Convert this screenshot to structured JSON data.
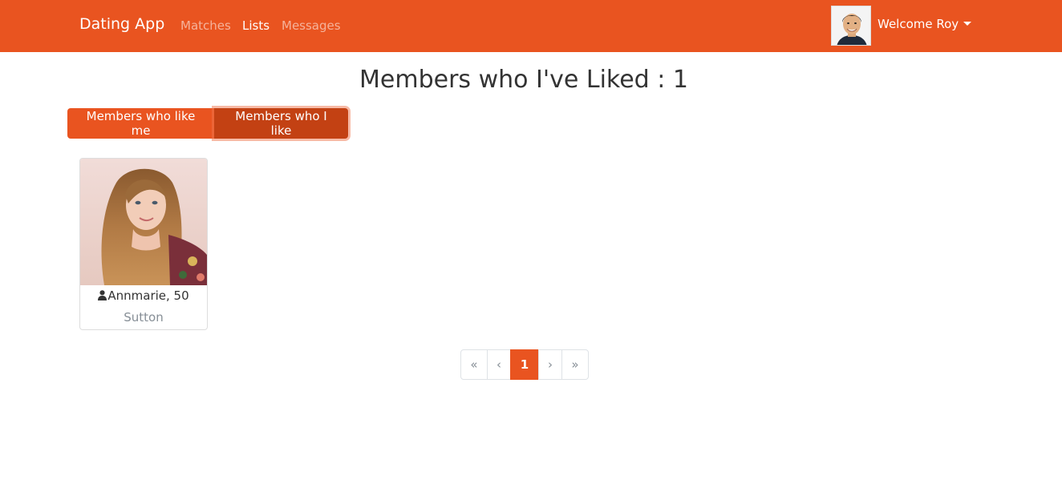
{
  "navbar": {
    "brand": "Dating App",
    "links": [
      {
        "label": "Matches",
        "active": false
      },
      {
        "label": "Lists",
        "active": true
      },
      {
        "label": "Messages",
        "active": false
      }
    ],
    "welcome": "Welcome Roy",
    "accent_color": "#E95420"
  },
  "page": {
    "title": "Members who I've Liked : 1"
  },
  "filter": {
    "likers_label": "Members who like me",
    "likees_label": "Members who I like",
    "selected": "likees"
  },
  "members": [
    {
      "name_age": "Annmarie, 50",
      "city": "Sutton",
      "icon": "user-icon"
    }
  ],
  "pagination": {
    "first": "«",
    "prev": "‹",
    "pages": [
      "1"
    ],
    "current": "1",
    "next": "›",
    "last": "»"
  }
}
